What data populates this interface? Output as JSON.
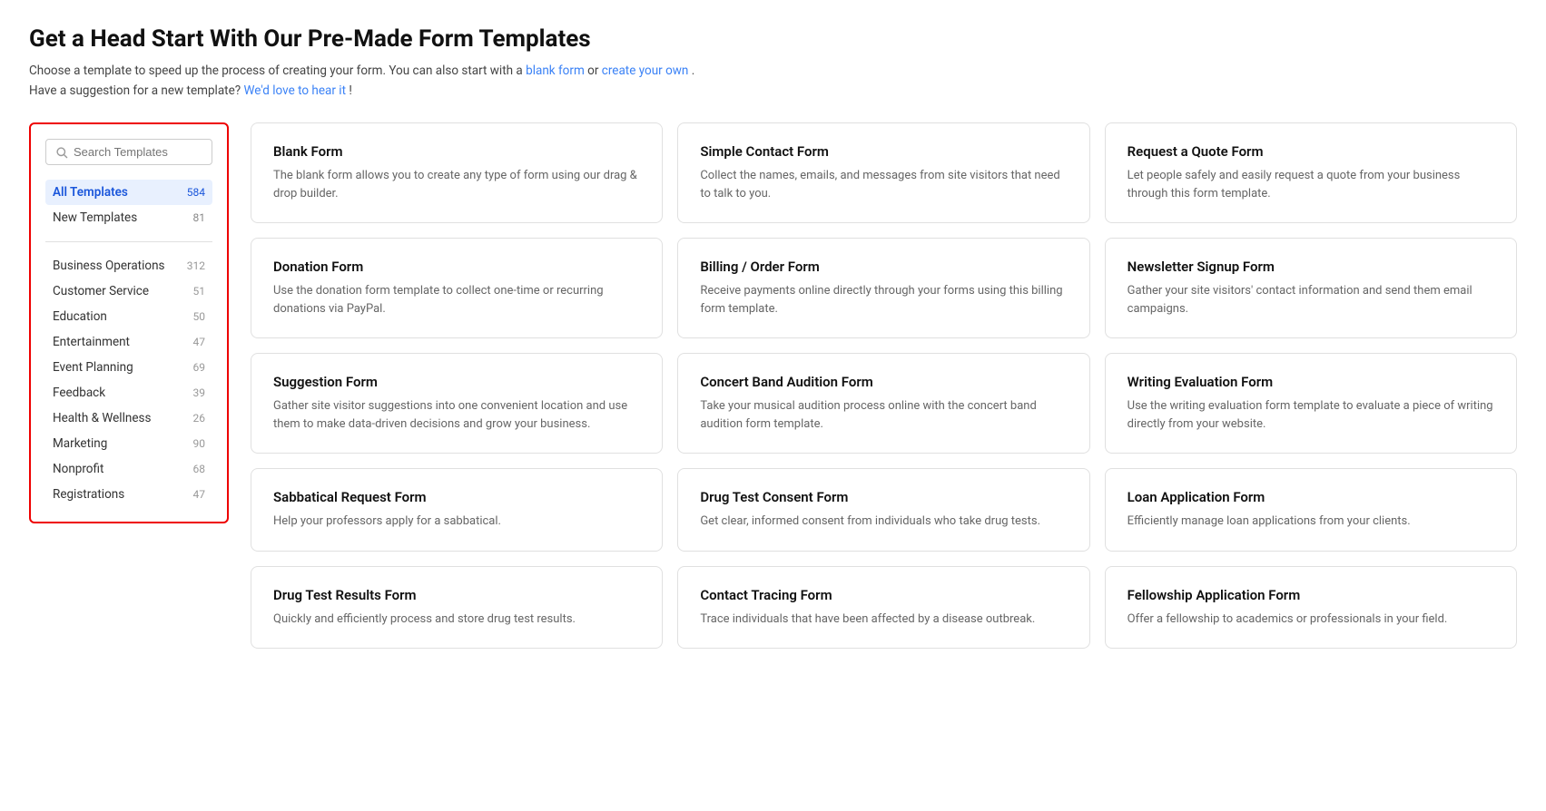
{
  "page": {
    "title": "Get a Head Start With Our Pre-Made Form Templates",
    "subtitle_text": "Choose a template to speed up the process of creating your form. You can also start with a",
    "subtitle_link1": "blank form",
    "subtitle_or": " or ",
    "subtitle_link2": "create your own",
    "subtitle_end": ".",
    "subtitle_line2": "Have a suggestion for a new template?",
    "subtitle_link3": "We'd love to hear it",
    "subtitle_exclaim": "!"
  },
  "sidebar": {
    "search_placeholder": "Search Templates",
    "primary_items": [
      {
        "label": "All Templates",
        "count": "584",
        "active": true
      },
      {
        "label": "New Templates",
        "count": "81",
        "active": false
      }
    ],
    "categories": [
      {
        "label": "Business Operations",
        "count": "312"
      },
      {
        "label": "Customer Service",
        "count": "51"
      },
      {
        "label": "Education",
        "count": "50"
      },
      {
        "label": "Entertainment",
        "count": "47"
      },
      {
        "label": "Event Planning",
        "count": "69"
      },
      {
        "label": "Feedback",
        "count": "39"
      },
      {
        "label": "Health & Wellness",
        "count": "26"
      },
      {
        "label": "Marketing",
        "count": "90"
      },
      {
        "label": "Nonprofit",
        "count": "68"
      },
      {
        "label": "Registrations",
        "count": "47"
      }
    ]
  },
  "templates": [
    {
      "title": "Blank Form",
      "desc": "The blank form allows you to create any type of form using our drag & drop builder."
    },
    {
      "title": "Simple Contact Form",
      "desc": "Collect the names, emails, and messages from site visitors that need to talk to you."
    },
    {
      "title": "Request a Quote Form",
      "desc": "Let people safely and easily request a quote from your business through this form template."
    },
    {
      "title": "Donation Form",
      "desc": "Use the donation form template to collect one-time or recurring donations via PayPal."
    },
    {
      "title": "Billing / Order Form",
      "desc": "Receive payments online directly through your forms using this billing form template."
    },
    {
      "title": "Newsletter Signup Form",
      "desc": "Gather your site visitors' contact information and send them email campaigns."
    },
    {
      "title": "Suggestion Form",
      "desc": "Gather site visitor suggestions into one convenient location and use them to make data-driven decisions and grow your business."
    },
    {
      "title": "Concert Band Audition Form",
      "desc": "Take your musical audition process online with the concert band audition form template."
    },
    {
      "title": "Writing Evaluation Form",
      "desc": "Use the writing evaluation form template to evaluate a piece of writing directly from your website."
    },
    {
      "title": "Sabbatical Request Form",
      "desc": "Help your professors apply for a sabbatical."
    },
    {
      "title": "Drug Test Consent Form",
      "desc": "Get clear, informed consent from individuals who take drug tests."
    },
    {
      "title": "Loan Application Form",
      "desc": "Efficiently manage loan applications from your clients."
    },
    {
      "title": "Drug Test Results Form",
      "desc": "Quickly and efficiently process and store drug test results."
    },
    {
      "title": "Contact Tracing Form",
      "desc": "Trace individuals that have been affected by a disease outbreak."
    },
    {
      "title": "Fellowship Application Form",
      "desc": "Offer a fellowship to academics or professionals in your field."
    }
  ]
}
